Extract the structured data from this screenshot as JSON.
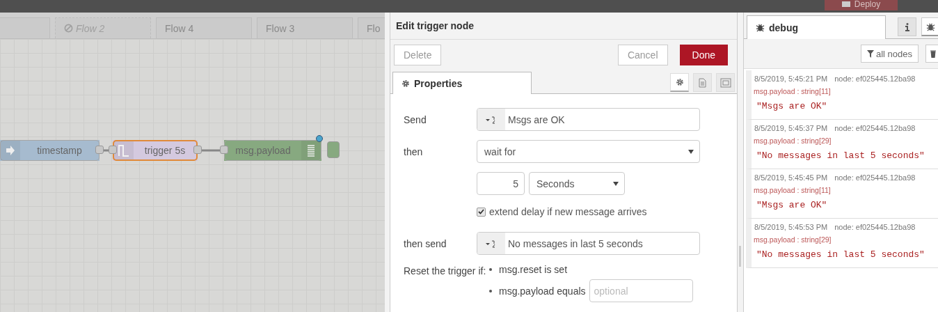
{
  "header": {
    "deploy": "Deploy"
  },
  "flow_tabs": [
    {
      "label": "Flow 2",
      "disabled": true
    },
    {
      "label": "Flow 4",
      "disabled": false
    },
    {
      "label": "Flow 3",
      "disabled": false
    },
    {
      "label": "Flo",
      "disabled": false
    }
  ],
  "nodes": [
    {
      "kind": "inject",
      "label": "timestamp",
      "selected": false
    },
    {
      "kind": "trigger",
      "label": "trigger 5s",
      "selected": true
    },
    {
      "kind": "debug",
      "label": "msg.payload",
      "selected": false
    }
  ],
  "editor": {
    "title": "Edit trigger node",
    "buttons": [
      {
        "kind": "plain",
        "label": "Delete"
      },
      {
        "kind": "plain",
        "label": "Cancel"
      },
      {
        "kind": "primary",
        "label": "Done"
      }
    ],
    "tabs": [
      {
        "label": "Properties",
        "selected": true
      }
    ],
    "icon_tabs": [
      {
        "kind": "settings",
        "selected": true
      },
      {
        "kind": "description",
        "selected": false
      },
      {
        "kind": "appearance",
        "selected": false
      }
    ],
    "send": {
      "label": "Send",
      "value": "Msgs are OK"
    },
    "then": {
      "label": "then",
      "value": "wait for"
    },
    "duration": {
      "value": "5",
      "unit": "Seconds"
    },
    "extend": {
      "label": "extend delay if new message arrives",
      "checked": true
    },
    "then_send": {
      "label": "then send",
      "value": "No messages in last 5 seconds"
    },
    "reset": {
      "label": "Reset the trigger if:",
      "conditions": [
        {
          "text": "msg.reset is set"
        },
        {
          "text": "msg.payload equals",
          "placeholder": "optional"
        }
      ]
    }
  },
  "sidebar": {
    "tab": {
      "label": "debug",
      "selected": true
    },
    "icon_tabs": [
      {
        "kind": "info",
        "selected": false
      },
      {
        "kind": "debug",
        "selected": true
      }
    ],
    "filter": "all nodes",
    "messages": [
      {
        "time": "8/5/2019, 5:45:21 PM",
        "node": "node: ef025445.12ba98",
        "type": "msg.payload : string[11]",
        "value": "\"Msgs are OK\""
      },
      {
        "time": "8/5/2019, 5:45:37 PM",
        "node": "node: ef025445.12ba98",
        "type": "msg.payload : string[29]",
        "value": "\"No messages in last 5 seconds\""
      },
      {
        "time": "8/5/2019, 5:45:45 PM",
        "node": "node: ef025445.12ba98",
        "type": "msg.payload : string[11]",
        "value": "\"Msgs are OK\""
      },
      {
        "time": "8/5/2019, 5:45:53 PM",
        "node": "node: ef025445.12ba98",
        "type": "msg.payload : string[29]",
        "value": "\"No messages in last 5 seconds\""
      }
    ]
  }
}
